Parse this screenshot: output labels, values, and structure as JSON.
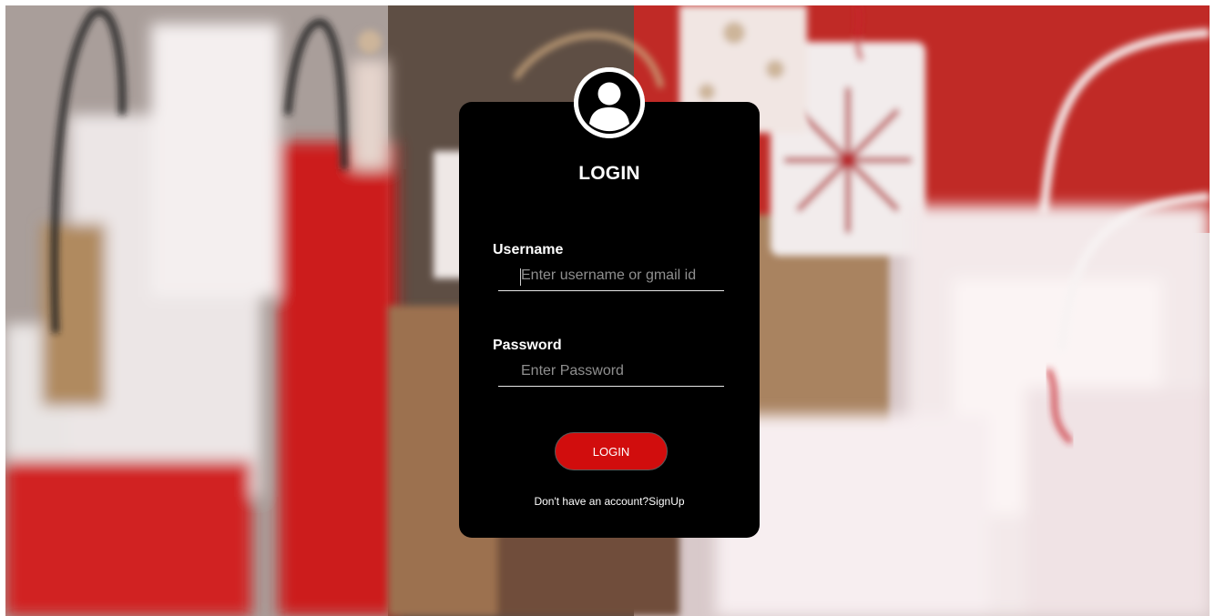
{
  "login": {
    "title": "LOGIN",
    "username_label": "Username",
    "username_placeholder": "Enter username or gmail id",
    "username_value": "",
    "password_label": "Password",
    "password_placeholder": "Enter Password",
    "password_value": "",
    "button_label": "LOGIN",
    "signup_prompt": "Don't have an account?",
    "signup_link": "SignUp"
  },
  "icons": {
    "avatar": "user-avatar-icon"
  },
  "colors": {
    "card_background": "#000000",
    "button_background": "#d10d0d",
    "text": "#ffffff",
    "placeholder": "#8f8f8f"
  }
}
